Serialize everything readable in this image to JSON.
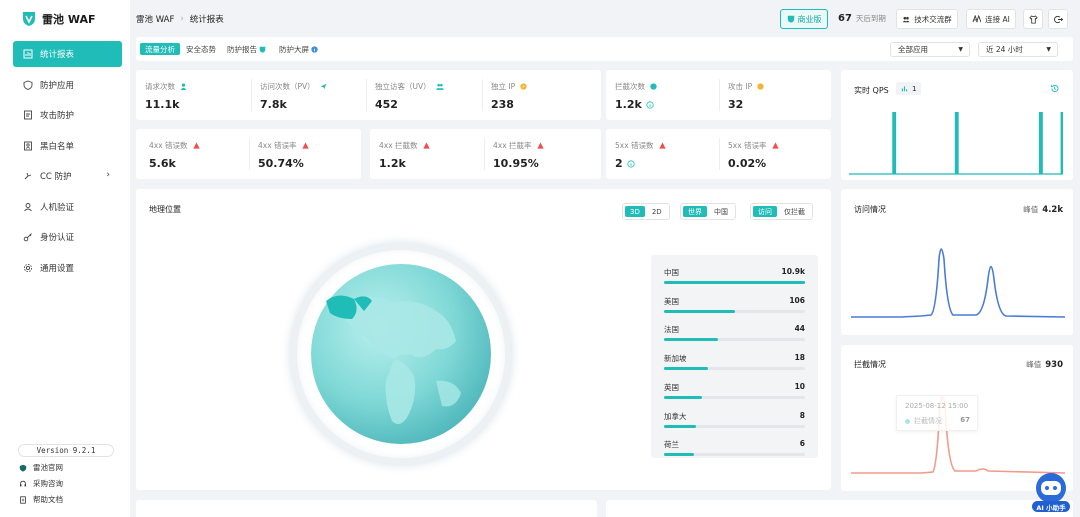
{
  "app": {
    "name": "雷池 WAF",
    "version": "Version 9.2.1",
    "accent": "#1fbcb8"
  },
  "sidebar": {
    "items": [
      {
        "label": "统计报表",
        "icon": "chart-icon",
        "active": true
      },
      {
        "label": "防护应用",
        "icon": "shield-icon"
      },
      {
        "label": "攻击防护",
        "icon": "attack-log-icon"
      },
      {
        "label": "黑白名单",
        "icon": "list-icon"
      },
      {
        "label": "CC 防护",
        "icon": "hand-icon",
        "has_children": true
      },
      {
        "label": "人机验证",
        "icon": "user-check-icon"
      },
      {
        "label": "身份认证",
        "icon": "key-icon"
      },
      {
        "label": "通用设置",
        "icon": "gear-icon"
      }
    ],
    "footer_links": [
      {
        "label": "雷池官网",
        "icon": "shield-icon"
      },
      {
        "label": "采购咨询",
        "icon": "headset-icon"
      },
      {
        "label": "帮助文档",
        "icon": "doc-icon"
      }
    ]
  },
  "header": {
    "breadcrumb": [
      "雷池 WAF",
      "统计报表"
    ],
    "edition": "商业版",
    "days_value": "67",
    "days_label": "天后到期",
    "tech_group": "技术交流群",
    "connect_ai": "连接 AI"
  },
  "tabs": [
    {
      "label": "流量分析",
      "active": true
    },
    {
      "label": "安全态势"
    },
    {
      "label": "防护报告"
    },
    {
      "label": "防护大屏"
    }
  ],
  "filters": {
    "app_select": "全部应用",
    "range_select": "近 24 小时"
  },
  "stats_top": [
    {
      "label": "请求次数",
      "value": "11.1k"
    },
    {
      "label": "访问次数（PV）",
      "value": "7.8k"
    },
    {
      "label": "独立访客（UV）",
      "value": "452"
    },
    {
      "label": "独立 IP",
      "value": "238"
    }
  ],
  "stats_attack": [
    {
      "label": "拦截次数",
      "value": "1.2k"
    },
    {
      "label": "攻击 IP",
      "value": "32"
    }
  ],
  "stats_4xx_a": [
    {
      "label": "4xx 错误数",
      "value": "5.6k"
    },
    {
      "label": "4xx 错误率",
      "value": "50.74%"
    }
  ],
  "stats_4xx_b": [
    {
      "label": "4xx 拦截数",
      "value": "1.2k"
    },
    {
      "label": "4xx 拦截率",
      "value": "10.95%"
    }
  ],
  "stats_5xx": [
    {
      "label": "5xx 错误数",
      "value": "2"
    },
    {
      "label": "5xx 错误率",
      "value": "0.02%"
    }
  ],
  "geo": {
    "title": "地理位置",
    "toggle_dim": [
      "3D",
      "2D"
    ],
    "toggle_region": [
      "世界",
      "中国"
    ],
    "toggle_type": [
      "访问",
      "仅拦截"
    ],
    "countries": [
      {
        "name": "中国",
        "value": "10.9k",
        "ratio": 1.0
      },
      {
        "name": "美国",
        "value": "106",
        "ratio": 0.5
      },
      {
        "name": "法国",
        "value": "44",
        "ratio": 0.38
      },
      {
        "name": "新加坡",
        "value": "18",
        "ratio": 0.31
      },
      {
        "name": "英国",
        "value": "10",
        "ratio": 0.27
      },
      {
        "name": "加拿大",
        "value": "8",
        "ratio": 0.23
      },
      {
        "name": "荷兰",
        "value": "6",
        "ratio": 0.21
      }
    ]
  },
  "qps": {
    "title": "实时 QPS",
    "badge": "1",
    "bars": [
      0,
      0,
      0,
      0,
      0,
      0,
      0,
      0,
      0,
      0,
      0,
      0,
      0,
      0,
      0,
      0,
      0,
      0,
      1,
      0,
      0,
      0,
      0,
      0,
      0,
      0,
      0,
      0,
      0,
      0,
      0,
      0,
      0,
      0,
      0,
      0,
      0,
      0,
      0,
      0,
      0,
      0,
      0,
      0,
      1,
      0,
      0,
      0,
      0,
      0,
      0,
      0,
      0,
      0,
      0,
      0,
      0,
      0,
      0,
      0,
      0,
      0,
      0,
      0,
      0,
      0,
      0,
      0,
      0,
      0,
      0,
      0,
      0,
      0,
      0,
      0,
      0,
      0,
      0,
      1,
      0,
      0,
      0,
      0,
      0,
      0,
      0,
      0,
      1
    ]
  },
  "visits": {
    "title": "访问情况",
    "peak_label": "峰值",
    "peak_value": "4.2k",
    "line_color": "#4a7bd8"
  },
  "blocks": {
    "title": "拦截情况",
    "peak_label": "峰值",
    "peak_value": "930",
    "line_color": "#f29a8a",
    "tooltip_time": "2025-08-12 15:00",
    "tooltip_label": "拦截情况",
    "tooltip_value": "67"
  },
  "assistant": {
    "label": "AI 小助手"
  }
}
